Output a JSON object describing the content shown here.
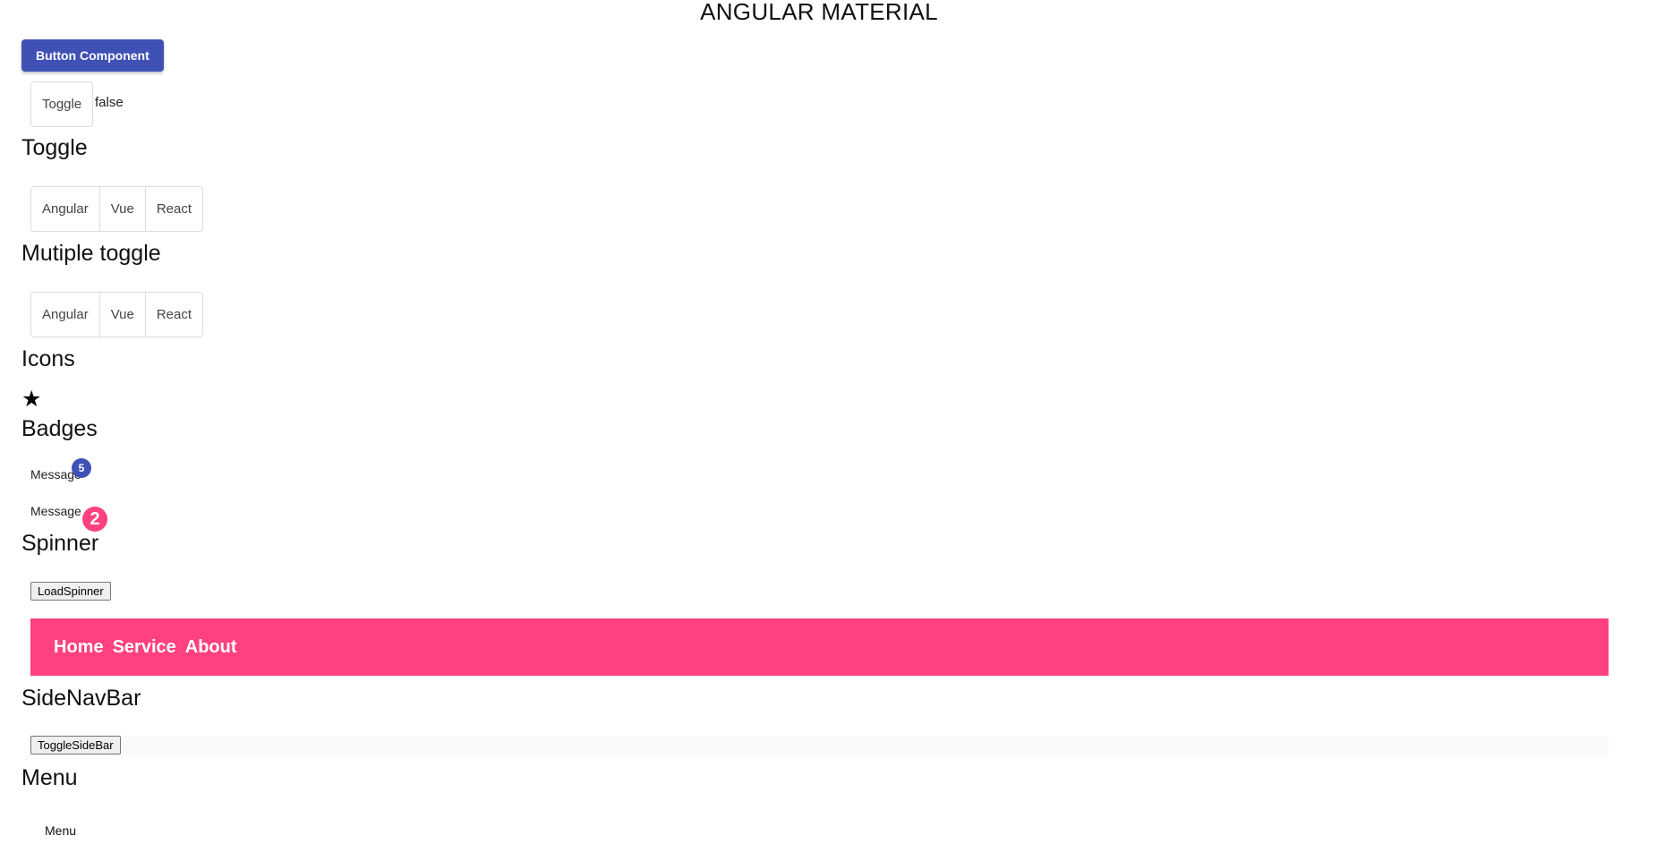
{
  "app": {
    "title": "ANGULAR MATERIAL"
  },
  "button_section": {
    "button_label": "Button Component"
  },
  "single_toggle": {
    "label": "Toggle",
    "value": "false"
  },
  "toggle_section": {
    "heading": "Toggle",
    "options": [
      "Angular",
      "Vue",
      "React"
    ]
  },
  "multiple_toggle_section": {
    "heading": "Mutiple toggle",
    "options": [
      "Angular",
      "Vue",
      "React"
    ]
  },
  "icons_section": {
    "heading": "Icons",
    "icon": "star-icon",
    "glyph": "★"
  },
  "badges_section": {
    "heading": "Badges",
    "items": [
      {
        "label": "Message",
        "count": "5",
        "color": "#3f51b5"
      },
      {
        "label": "Message",
        "count": "2",
        "color": "#ff4081"
      }
    ]
  },
  "spinner_section": {
    "heading": "Spinner",
    "button_label": "LoadSpinner"
  },
  "toolbar": {
    "color": "#ff4081",
    "links": [
      "Home",
      "Service",
      "About"
    ]
  },
  "sidenav_section": {
    "heading": "SideNavBar",
    "button_label": "ToggleSideBar"
  },
  "menu_section": {
    "heading": "Menu",
    "trigger_label": "Menu"
  }
}
